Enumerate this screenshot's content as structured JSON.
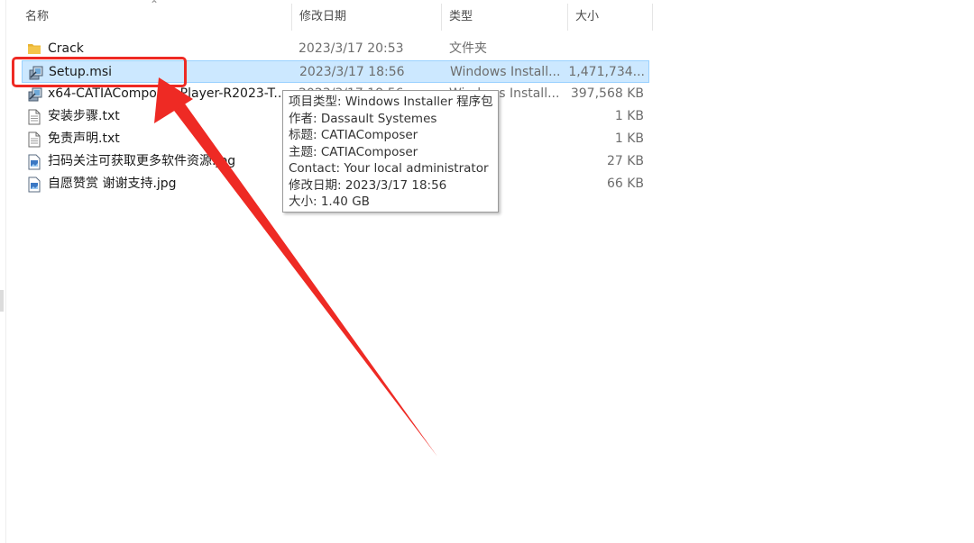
{
  "columns": {
    "name": "名称",
    "date": "修改日期",
    "type": "类型",
    "size": "大小"
  },
  "files": [
    {
      "name": "Crack",
      "date": "2023/3/17 20:53",
      "type": "文件夹",
      "size": "",
      "icon": "folder-icon"
    },
    {
      "name": "Setup.msi",
      "date": "2023/3/17 18:56",
      "type": "Windows Install...",
      "size": "1,471,734...",
      "icon": "msi-installer-icon"
    },
    {
      "name": "x64-CATIAComposer-Player-R2023-T...",
      "date": "2023/3/17 18:56",
      "type": "Windows Install...",
      "size": "397,568 KB",
      "icon": "msi-installer-icon"
    },
    {
      "name": "安装步骤.txt",
      "date": "",
      "type": "",
      "size": "1 KB",
      "icon": "text-file-icon"
    },
    {
      "name": "免责声明.txt",
      "date": "",
      "type": "",
      "size": "1 KB",
      "icon": "text-file-icon"
    },
    {
      "name": "扫码关注可获取更多软件资源.jpg",
      "date": "",
      "type": "",
      "size": "27 KB",
      "icon": "image-file-icon"
    },
    {
      "name": "自愿赞赏 谢谢支持.jpg",
      "date": "",
      "type": "",
      "size": "66 KB",
      "icon": "image-file-icon"
    }
  ],
  "selected_index": 1,
  "tooltip": {
    "lines": [
      "项目类型: Windows Installer 程序包",
      "作者: Dassault Systemes",
      "标题: CATIAComposer",
      "主题: CATIAComposer",
      "Contact:  Your local administrator",
      "修改日期: 2023/3/17 18:56",
      "大小: 1.40 GB"
    ]
  },
  "colors": {
    "selection_bg": "#cce8ff",
    "selection_border": "#99d1ff",
    "annotation_red": "#ee2a24",
    "folder_yellow": "#f4c54a"
  }
}
